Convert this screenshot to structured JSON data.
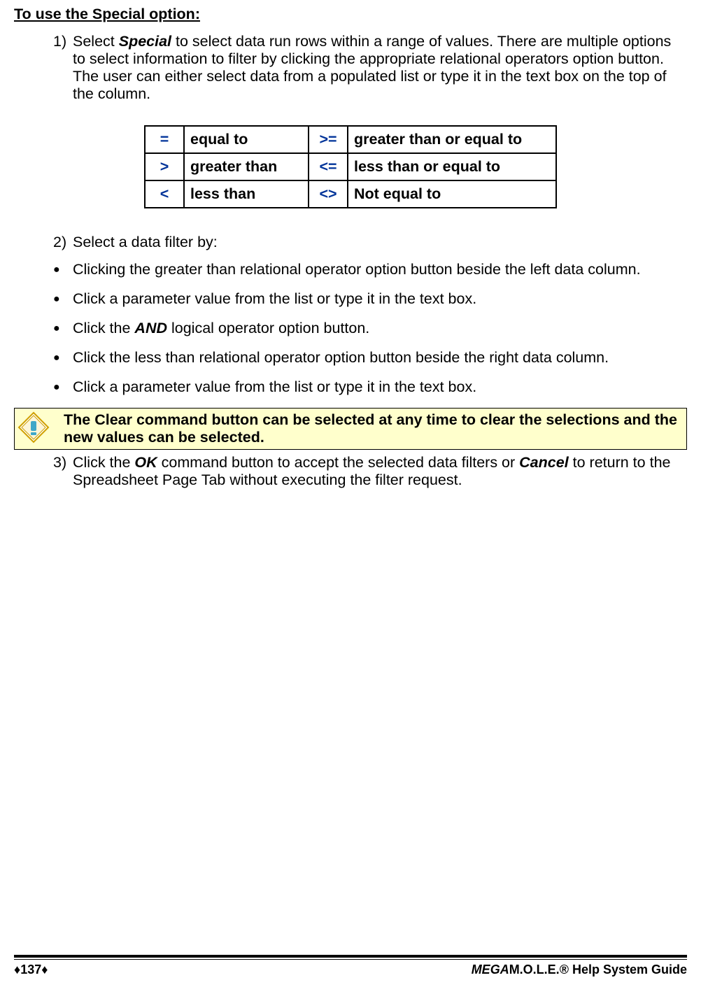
{
  "heading": "To use the Special option:",
  "step1_num": "1)",
  "step1_pre": "Select ",
  "step1_bold": "Special",
  "step1_post": " to select data run rows within a range of values. There are multiple options to select information to filter by clicking the appropriate relational operators option button. The user can either select data from a populated list or type it in the text box on the top of the column.",
  "ops": {
    "r1c1": "=",
    "r1c2": "equal to",
    "r1c3": ">=",
    "r1c4": "greater than or equal to",
    "r2c1": ">",
    "r2c2": "greater than",
    "r2c3": "<=",
    "r2c4": "less than or equal to",
    "r3c1": "<",
    "r3c2": "less than",
    "r3c3": "<>",
    "r3c4": "Not equal to"
  },
  "step2_num": "2)",
  "step2_txt": "Select a data filter by:",
  "b1": "Clicking the greater than relational operator option button beside the left data column.",
  "b2": "Click a parameter value from the list or type it in the text box.",
  "b3_pre": "Click the ",
  "b3_bold": "AND",
  "b3_post": " logical operator option button.",
  "b4": "Click the less than relational operator option button beside the right data column.",
  "b5": "Click a parameter value from the list or type it in the text box.",
  "note": "The Clear command button can be selected at any time to clear the selections and the new values can be selected.",
  "step3_num": "3)",
  "step3_pre": "Click the ",
  "step3_b1": "OK",
  "step3_mid": " command button to accept the selected data filters or ",
  "step3_b2": "Cancel",
  "step3_post": " to return to the Spreadsheet Page Tab without executing the filter request.",
  "footer": {
    "page": "137",
    "diamond": "♦",
    "title_mega": "MEGA",
    "title_rest": "M.O.L.E.® Help System Guide"
  }
}
